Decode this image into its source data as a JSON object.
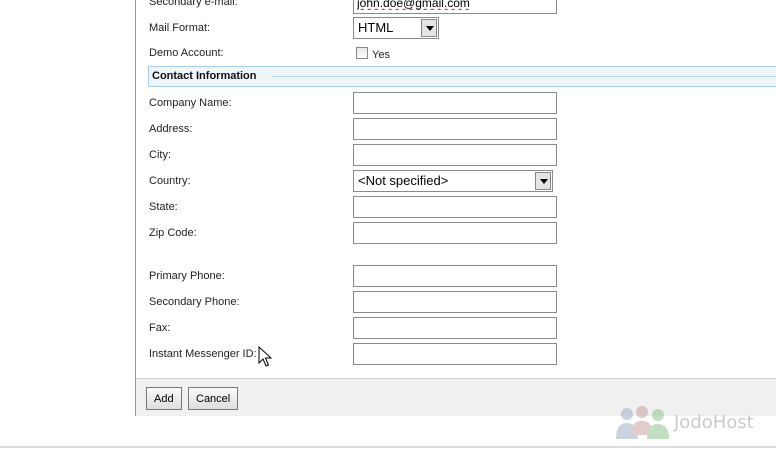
{
  "form": {
    "secondary_email": {
      "label": "Secondary e-mail:",
      "value": "john.doe@gmail.com"
    },
    "mail_format": {
      "label": "Mail Format:",
      "value": "HTML"
    },
    "demo_account": {
      "label": "Demo Account:",
      "option_label": "Yes",
      "checked": false
    },
    "contact_section_title": "Contact Information",
    "company_name": {
      "label": "Company Name:",
      "value": ""
    },
    "address": {
      "label": "Address:",
      "value": ""
    },
    "city": {
      "label": "City:",
      "value": ""
    },
    "country": {
      "label": "Country:",
      "value": "<Not specified>"
    },
    "state": {
      "label": "State:",
      "value": ""
    },
    "zip_code": {
      "label": "Zip Code:",
      "value": ""
    },
    "primary_phone": {
      "label": "Primary Phone:",
      "value": ""
    },
    "secondary_phone": {
      "label": "Secondary Phone:",
      "value": ""
    },
    "fax": {
      "label": "Fax:",
      "value": ""
    },
    "instant_messenger": {
      "label": "Instant Messenger ID:",
      "value": ""
    }
  },
  "buttons": {
    "add": "Add",
    "cancel": "Cancel"
  },
  "watermark": {
    "text": "JodoHost"
  },
  "icons": {
    "cursor": "mouse-pointer-icon",
    "logo": "people-logo-icon"
  },
  "colors": {
    "section_bg": "#eef6fc",
    "section_border": "#a8cde6",
    "footer_bg": "#f0f0f0"
  }
}
